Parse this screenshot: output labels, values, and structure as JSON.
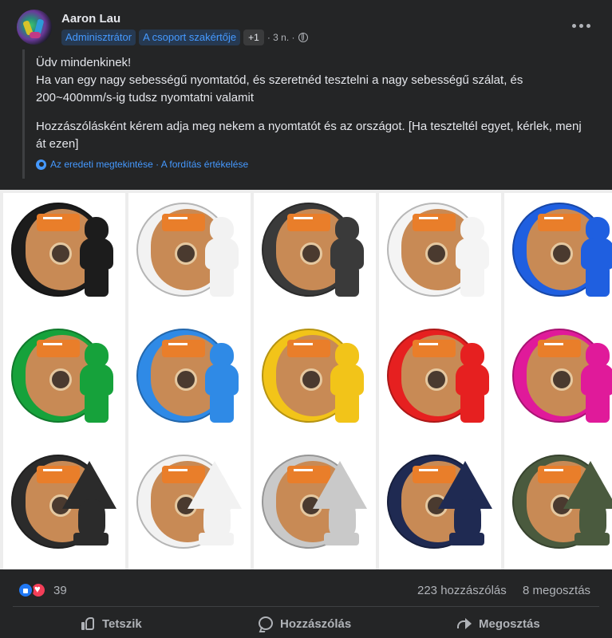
{
  "post": {
    "author": "Aaron Lau",
    "badges": [
      "Adminisztrátor",
      "A csoport szakértője"
    ],
    "badge_extra": "+1",
    "time": "· 3 n. ·",
    "paragraph1": "Üdv mindenkinek!\nHa van egy nagy sebességű nyomtatód, és szeretnéd tesztelni a nagy sebességű szálat, és 200~400mm/s-ig tudsz nyomtatni valamit",
    "paragraph2": "Hozzászólásként kérem adja meg nekem a nyomtatót és az országot. [Ha teszteltél egyet, kérlek, menj át ezen]",
    "translation_links": "Az eredeti megtekintése · A fordítás értékelése"
  },
  "photo": {
    "rows": [
      {
        "kind": "bust",
        "colors": [
          "#1c1c1c",
          "#f2f2f2",
          "#3a3a3a",
          "#f4f4f4",
          "#1f5fe0"
        ]
      },
      {
        "kind": "bust",
        "colors": [
          "#16a23b",
          "#2f8ae6",
          "#f2c419",
          "#e62020",
          "#e01a9a"
        ]
      },
      {
        "kind": "dragon",
        "colors": [
          "#2b2b2b",
          "#f2f2f2",
          "#c9c9c9",
          "#1f2a52",
          "#4a5a3e"
        ]
      }
    ]
  },
  "stats": {
    "reaction_count": "39",
    "comments": "223 hozzászólás",
    "shares": "8 megosztás"
  },
  "actions": {
    "like": "Tetszik",
    "comment": "Hozzászólás",
    "share": "Megosztás"
  }
}
